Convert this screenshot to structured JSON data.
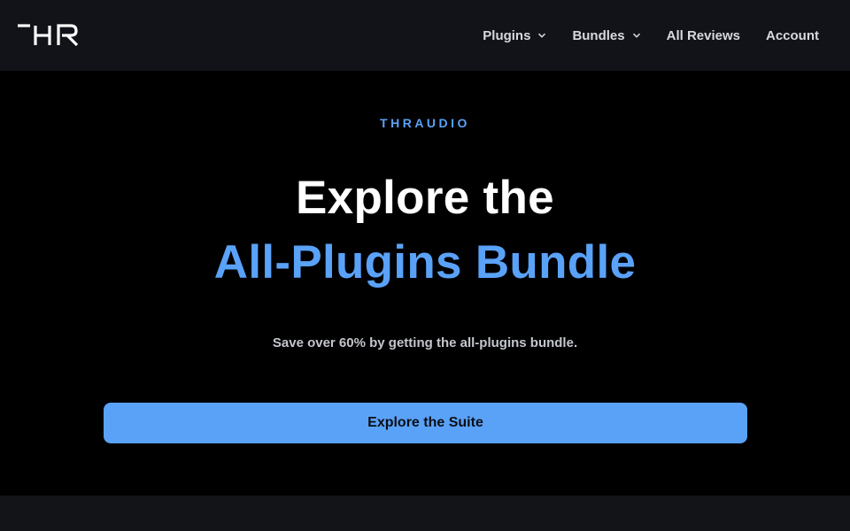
{
  "header": {
    "logo_text": "THR",
    "nav": [
      {
        "label": "Plugins",
        "has_dropdown": true
      },
      {
        "label": "Bundles",
        "has_dropdown": true
      },
      {
        "label": "All Reviews",
        "has_dropdown": false
      },
      {
        "label": "Account",
        "has_dropdown": false
      }
    ]
  },
  "hero": {
    "eyebrow": "THRAUDIO",
    "title_line1": "Explore the",
    "title_line2": "All-Plugins Bundle",
    "subtitle": "Save over 60% by getting the all-plugins bundle.",
    "cta_label": "Explore the Suite"
  },
  "colors": {
    "accent": "#5aa2f8",
    "nav_background": "#111318",
    "page_background": "#000000",
    "cta_text": "#0c0f16"
  },
  "icons": [
    "logo-icon",
    "chevron-down-icon"
  ]
}
